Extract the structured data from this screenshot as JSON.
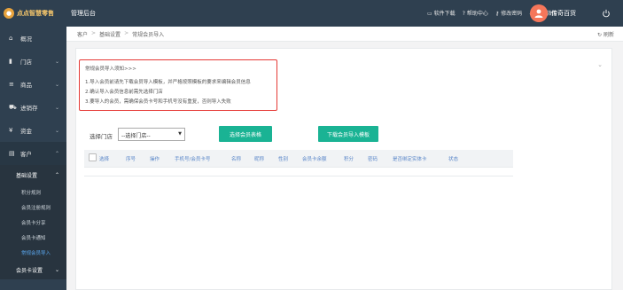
{
  "header": {
    "logo_text": "点点智慧零售",
    "app_title": "管理后台",
    "actions": [
      "软件下载",
      "帮助中心",
      "修改密码",
      "绑定微信"
    ],
    "username": "传奇百货"
  },
  "sidebar": {
    "items": [
      {
        "label": "概况",
        "icon": "home-icon"
      },
      {
        "label": "门店",
        "icon": "store-icon"
      },
      {
        "label": "商品",
        "icon": "list-icon"
      },
      {
        "label": "进销存",
        "icon": "truck-icon"
      },
      {
        "label": "资金",
        "icon": "yen-icon"
      },
      {
        "label": "客户",
        "icon": "id-card-icon"
      }
    ],
    "submenu_title": "基础设置",
    "submenu_items": [
      "积分规则",
      "会员注册规则",
      "会员卡分享",
      "会员卡通知",
      "常规会员导入"
    ],
    "next_group": "会员卡设置"
  },
  "breadcrumb": {
    "items": [
      "客户",
      "基础设置",
      "常规会员导入"
    ],
    "refresh_label": "刷新"
  },
  "notice": {
    "title": "常规会员导入须知>>>",
    "lines": [
      "1.导入会员前请先下载会员导入模板，并严格按照模板的要求来编辑会员信息",
      "2.确认导入会员信息前需先选择门店",
      "3.要导入的会员，需确保会员卡号和手机号没有重复，否则导入失败"
    ]
  },
  "form": {
    "store_label": "选择门店",
    "store_value": "--选择门店--",
    "choose_button": "选择会员表格",
    "download_button": "下载会员导入模板"
  },
  "table": {
    "columns": [
      "选择",
      "序号",
      "操作",
      "手机号/会员卡号",
      "名称",
      "昵称",
      "性别",
      "会员卡余额",
      "积分",
      "密码",
      "是否绑定实体卡",
      "状态"
    ],
    "rows": []
  },
  "colors": {
    "sidebar_bg": "#2f4050",
    "primary_button": "#1ab394",
    "notice_border": "#e53935",
    "avatar_bg": "#f5765a"
  }
}
